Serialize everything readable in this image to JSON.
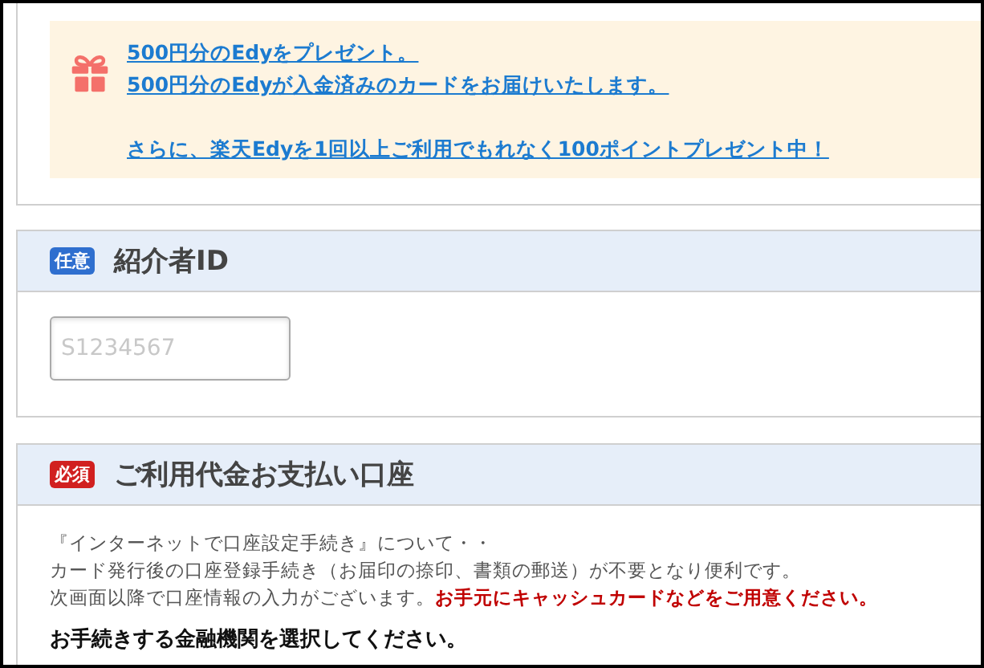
{
  "campaign": {
    "groups": [
      [
        "500円分のEdyをプレゼント。",
        "500円分のEdyが入金済みのカードをお届けいたします。"
      ],
      [
        "さらに、楽天Edyを1回以上ご利用でもれなく100ポイントプレゼント中！"
      ]
    ]
  },
  "sections": [
    {
      "badge": {
        "text": "任意",
        "kind": "optional"
      },
      "title": "紹介者ID",
      "field": {
        "placeholder": "S1234567"
      }
    },
    {
      "badge": {
        "text": "必須",
        "kind": "required"
      },
      "title": "ご利用代金お支払い口座",
      "paragraphs": [
        [
          {
            "text": "『インターネットで口座設定手続き』について・・",
            "kind": "normal"
          }
        ],
        [
          {
            "text": "カード発行後の口座登録手続き（お届印の捺印、書類の郵送）が不要となり便利です。",
            "kind": "normal"
          }
        ],
        [
          {
            "text": "次画面以降で口座情報の入力がございます。",
            "kind": "normal"
          },
          {
            "text": "お手元にキャッシュカードなどをご用意ください。",
            "kind": "alert"
          }
        ]
      ],
      "prompt": "お手続きする金融機関を選択してください。"
    }
  ]
}
